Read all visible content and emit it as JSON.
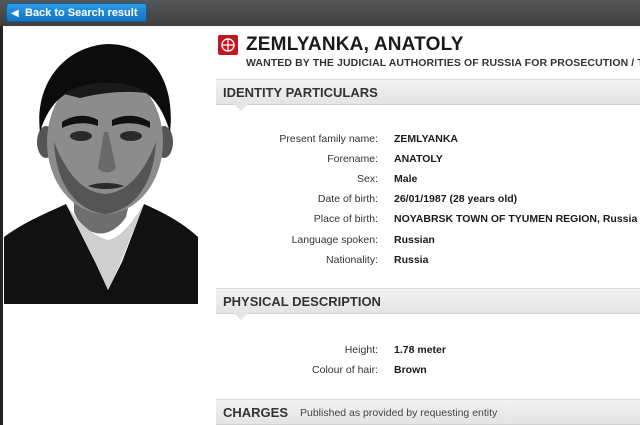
{
  "top_bar": {
    "back_label": "Back to Search result"
  },
  "header": {
    "name": "ZEMLYANKA, ANATOLY",
    "subtitle": "WANTED BY THE JUDICIAL AUTHORITIES OF RUSSIA FOR PROSECUTION / TO"
  },
  "identity": {
    "title": "IDENTITY PARTICULARS",
    "rows": [
      {
        "label": "Present family name:",
        "value": "ZEMLYANKA"
      },
      {
        "label": "Forename:",
        "value": "ANATOLY"
      },
      {
        "label": "Sex:",
        "value": "Male"
      },
      {
        "label": "Date of birth:",
        "value": "26/01/1987 (28 years old)"
      },
      {
        "label": "Place of birth:",
        "value": "NOYABRSK TOWN OF TYUMEN REGION, Russia"
      },
      {
        "label": "Language spoken:",
        "value": "Russian"
      },
      {
        "label": "Nationality:",
        "value": "Russia"
      }
    ]
  },
  "physical": {
    "title": "PHYSICAL DESCRIPTION",
    "rows": [
      {
        "label": "Height:",
        "value": "1.78 meter"
      },
      {
        "label": "Colour of hair:",
        "value": "Brown"
      }
    ]
  },
  "charges": {
    "title": "CHARGES",
    "note": "Published as provided by requesting entity"
  },
  "colors": {
    "back_button": "#1a86d6",
    "top_bar": "#4a4a4a",
    "emblem": "#c8141e"
  }
}
